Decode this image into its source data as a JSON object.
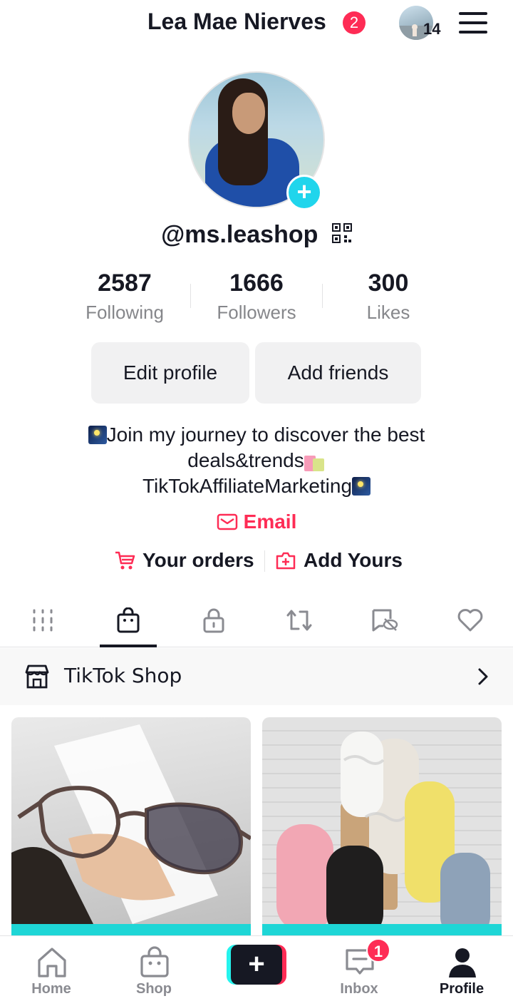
{
  "header": {
    "title": "Lea Mae Nierves",
    "notification_count": "2",
    "account_switch_count": "14"
  },
  "profile": {
    "username": "@ms.leashop",
    "stats": [
      {
        "value": "2587",
        "label": "Following"
      },
      {
        "value": "1666",
        "label": "Followers"
      },
      {
        "value": "300",
        "label": "Likes"
      }
    ],
    "buttons": {
      "edit_profile": "Edit profile",
      "add_friends": "Add friends"
    },
    "bio": {
      "line1": "Join my journey to discover the best",
      "line2": "deals&trends",
      "line3": "TikTokAffiliateMarketing"
    },
    "email_label": "Email",
    "orders_label": "Your orders",
    "add_yours_label": "Add Yours"
  },
  "tabs": {
    "items": [
      "grid-icon",
      "shopping-bag-icon",
      "lock-icon",
      "repost-icon",
      "hidden-icon",
      "heart-icon"
    ],
    "active_index": 1
  },
  "shop_row": {
    "label": "TikTok Shop"
  },
  "products": [
    {
      "name": "sunglasses-product",
      "description_icon": "glasses"
    },
    {
      "name": "sandals-product",
      "description_icon": "sandals"
    }
  ],
  "bottom_nav": {
    "items": [
      {
        "label": "Home",
        "icon": "home-icon"
      },
      {
        "label": "Shop",
        "icon": "shop-icon"
      },
      {
        "label": "",
        "icon": "plus-icon"
      },
      {
        "label": "Inbox",
        "icon": "inbox-icon"
      },
      {
        "label": "Profile",
        "icon": "profile-icon"
      }
    ],
    "inbox_badge": "1",
    "active": "Profile"
  },
  "colors": {
    "accent_red": "#fe2c55",
    "accent_cyan": "#20d5ec",
    "text_primary": "#161823",
    "text_secondary": "#86878b"
  }
}
